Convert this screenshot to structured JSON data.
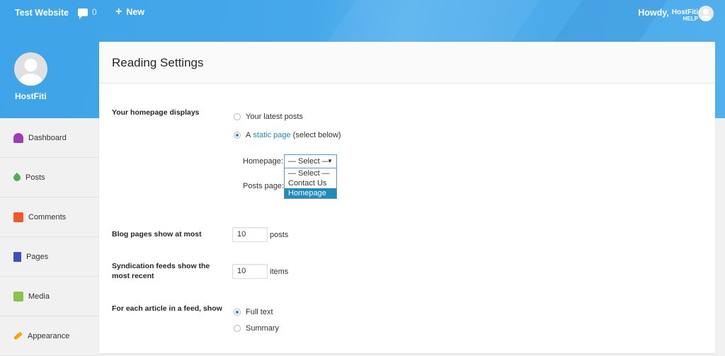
{
  "adminbar": {
    "site_name": "Test Website",
    "comment_count": "0",
    "new_label": "New",
    "howdy": "Howdy,",
    "brand_line1": "HostFiti",
    "brand_line2": "HELP"
  },
  "sidebar": {
    "profile_name": "HostFiti",
    "items": [
      {
        "label": "Dashboard",
        "icon": "dashboard-icon"
      },
      {
        "label": "Posts",
        "icon": "pin-icon"
      },
      {
        "label": "Comments",
        "icon": "comment-icon"
      },
      {
        "label": "Pages",
        "icon": "pages-icon"
      },
      {
        "label": "Media",
        "icon": "media-icon"
      },
      {
        "label": "Appearance",
        "icon": "brush-icon"
      }
    ]
  },
  "page": {
    "title": "Reading Settings"
  },
  "homepage_displays": {
    "label": "Your homepage displays",
    "option_latest": "Your latest posts",
    "option_static_prefix": "A",
    "option_static_link": "static page",
    "option_static_suffix": "(select below)",
    "selected": "static",
    "homepage_label": "Homepage:",
    "homepage_value": "— Select —",
    "posts_page_label": "Posts page:",
    "dropdown_options": [
      "— Select —",
      "Contact Us",
      "Homepage"
    ],
    "dropdown_highlighted": "Homepage"
  },
  "blog_pages": {
    "label": "Blog pages show at most",
    "value": "10",
    "unit": "posts"
  },
  "syndication": {
    "label": "Syndication feeds show the most recent",
    "value": "10",
    "unit": "items"
  },
  "feed_article": {
    "label": "For each article in a feed, show",
    "option_full": "Full text",
    "option_summary": "Summary",
    "selected": "full"
  },
  "colors": {
    "header_blue": "#46a8ea",
    "link_blue": "#1e8cbe"
  }
}
